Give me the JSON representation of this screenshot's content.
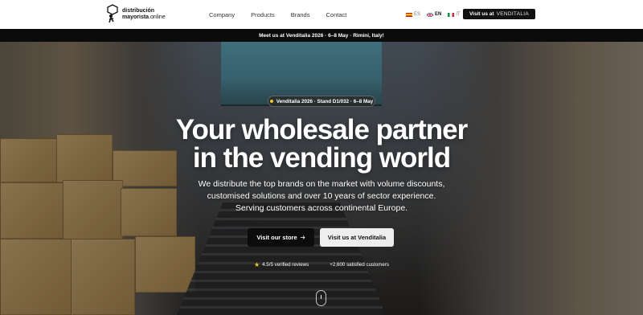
{
  "header": {
    "logo": {
      "line1": "distribución",
      "line2_bold": "mayorista",
      "line2_light": ".online"
    },
    "nav": [
      "Company",
      "Products",
      "Brands",
      "Contact"
    ],
    "languages": [
      {
        "code": "ES",
        "flag_colors": [
          "#c60b1e",
          "#ffc400",
          "#c60b1e"
        ],
        "active": false
      },
      {
        "code": "EN",
        "flag_colors": [
          "#012169",
          "#ffffff",
          "#c8102e"
        ],
        "active": true
      },
      {
        "code": "IT",
        "flag_colors": [
          "#009246",
          "#ffffff",
          "#ce2b37"
        ],
        "active": false
      }
    ],
    "cta": {
      "label": "Visit us at",
      "brand": "VENDITALIA"
    }
  },
  "announcement": "Meet us at Venditalia 2026 · 6–8 May · Rimini, Italy!",
  "hero": {
    "badge": "Venditalia 2026 · Stand D1/032 · 6–8 May",
    "title_line1": "Your wholesale partner",
    "title_line2": "in the vending world",
    "subtitle_line1": "We distribute the top brands on the market with volume discounts,",
    "subtitle_line2": "customised solutions and over 10 years of sector experience.",
    "subtitle_line3": "Serving customers across continental Europe.",
    "primary_button": {
      "label": "Visit our store",
      "icon": "arrow-right-icon"
    },
    "secondary_button": {
      "label": "Visit us at Venditalia"
    },
    "stats": [
      {
        "icon": "star-icon",
        "text": "4.5/5 verified reviews"
      },
      {
        "text": "+2,600 satisfied customers"
      }
    ]
  },
  "colors": {
    "accent": "#f3c531",
    "dark": "#0c0c0c"
  }
}
